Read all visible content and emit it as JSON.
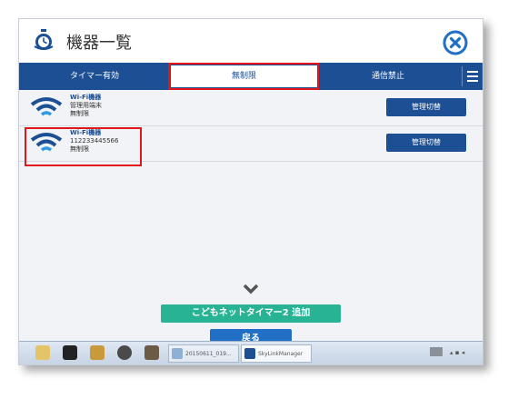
{
  "window": {
    "title": "機器一覧"
  },
  "tabs": [
    {
      "label": "タイマー有効"
    },
    {
      "label": "無制限"
    },
    {
      "label": "通信禁止"
    }
  ],
  "devices": [
    {
      "name": "Wi-Fi機器",
      "line2": "管理用端末",
      "status": "無制限",
      "button": "管理切替"
    },
    {
      "name": "Wi-Fi機器",
      "line2": "112233445566",
      "status": "無制限",
      "button": "管理切替"
    }
  ],
  "actions": {
    "add_label": "こどもネットタイマー2 追加",
    "back_label": "戻る"
  },
  "taskbar": {
    "task1": "20150611_019...",
    "task2": "SkyLinkManager"
  },
  "colors": {
    "brand_blue": "#1c4f93",
    "add_green": "#27b394",
    "back_blue": "#2170c5",
    "highlight_red": "#e0161b"
  }
}
